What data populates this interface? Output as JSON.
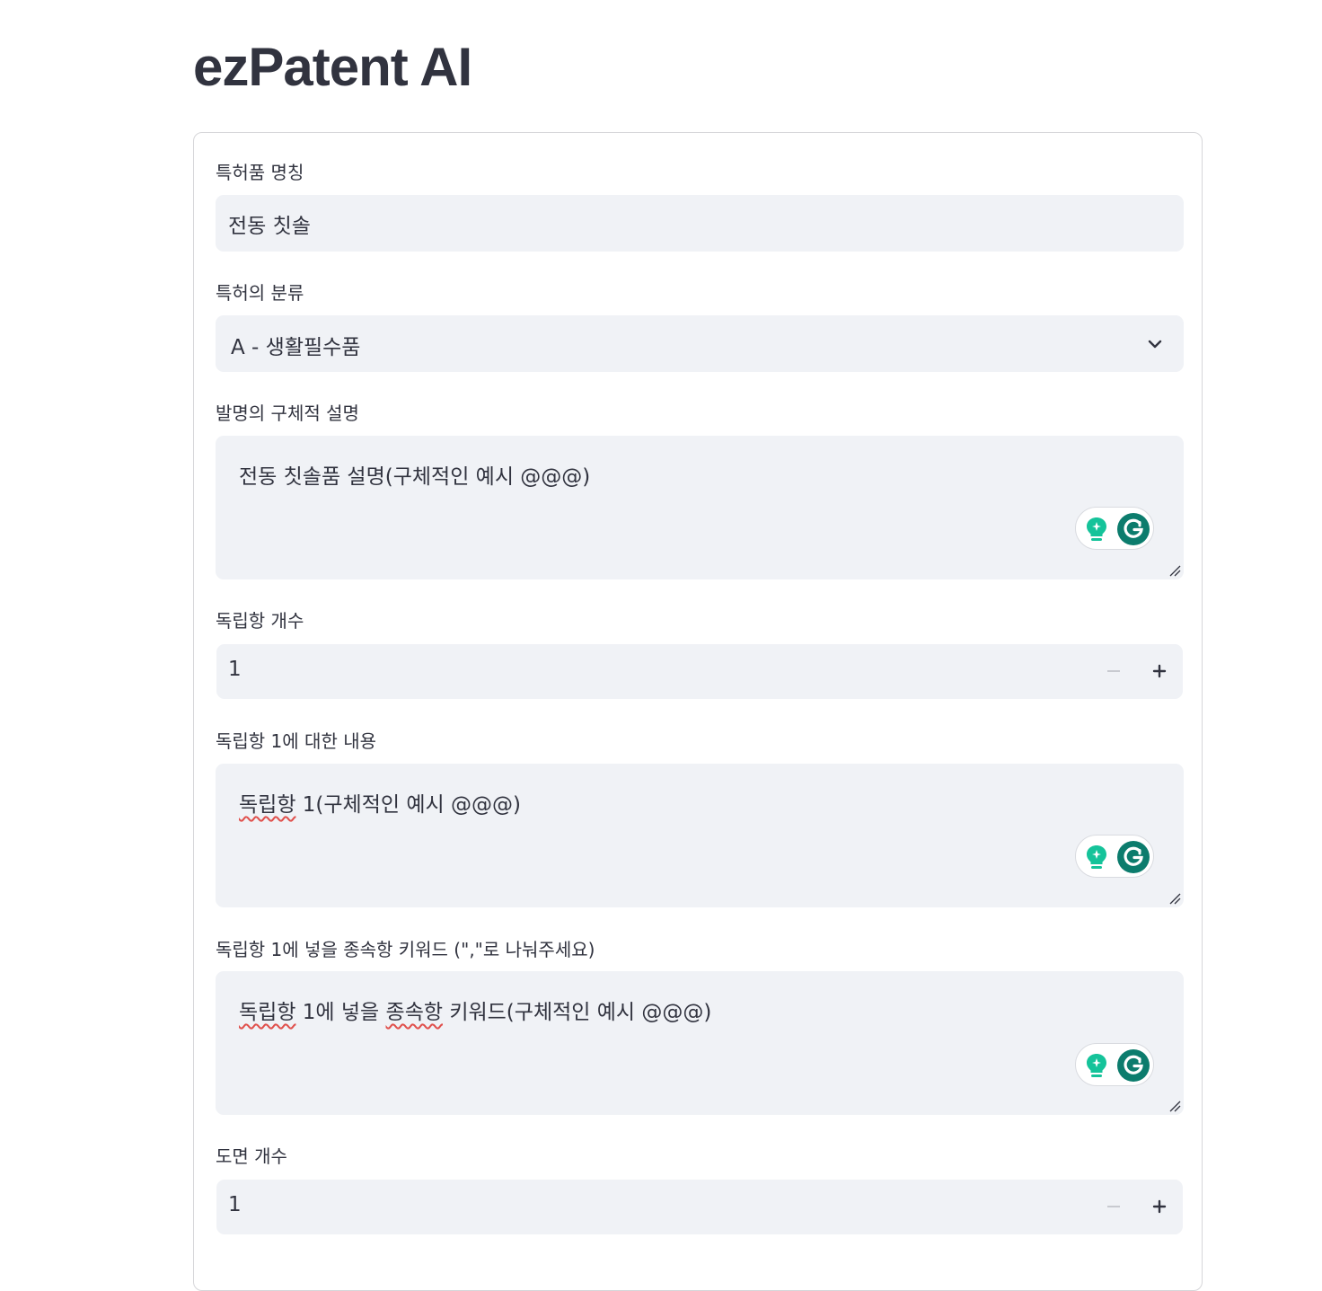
{
  "app": {
    "title": "ezPatent AI"
  },
  "form": {
    "product_name": {
      "label": "특허품 명칭",
      "value": "전동 칫솔"
    },
    "category": {
      "label": "특허의 분류",
      "selected": "A - 생활필수품"
    },
    "description": {
      "label": "발명의 구체적 설명",
      "value": "전동 칫솔품 설명(구체적인 예시 @@@)"
    },
    "independent_count": {
      "label": "독립항 개수",
      "value": "1"
    },
    "independent_1": {
      "label": "독립항 1에 대한 내용",
      "value_word": "독립항",
      "value_rest": " 1(구체적인 예시 @@@)"
    },
    "dependent_keywords_1": {
      "label": "독립항 1에 넣을 종속항 키워드 (\",\"로 나눠주세요)",
      "value_a": "독립항",
      "value_b": " 1에 넣을 ",
      "value_c": "종속항",
      "value_d": " 키워드(구체적인 예시 @@@)"
    },
    "drawing_count": {
      "label": "도면 개수",
      "value": "1"
    }
  },
  "icons": {
    "select_arrow": "chevron-down-icon",
    "resize": "resize-handle-icon",
    "grammarly_bulb": "lightbulb-icon",
    "grammarly_logo": "grammarly-icon",
    "minus": "minus-icon",
    "plus": "plus-icon"
  },
  "colors": {
    "accent_green": "#15c39a",
    "grammarly_dark": "#0c7c6d",
    "field_bg": "#f0f2f6",
    "text": "#31333f"
  }
}
